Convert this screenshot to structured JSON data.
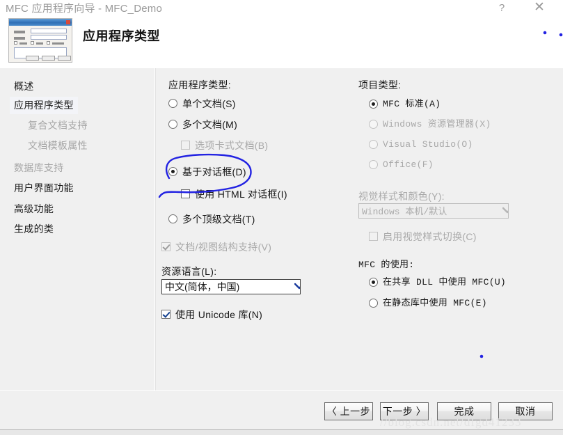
{
  "window": {
    "title": "MFC 应用程序向导 - MFC_Demo",
    "help_icon": "?",
    "close_icon": "✕"
  },
  "header": {
    "title": "应用程序类型",
    "icon_name": "wizard-dialog-preview-icon"
  },
  "sidebar": {
    "items": [
      {
        "label": "概述",
        "state": "normal",
        "indent": false
      },
      {
        "label": "应用程序类型",
        "state": "selected",
        "indent": false
      },
      {
        "label": "复合文档支持",
        "state": "disabled",
        "indent": true
      },
      {
        "label": "文档模板属性",
        "state": "disabled",
        "indent": true
      },
      {
        "label": "数据库支持",
        "state": "disabled",
        "indent": false
      },
      {
        "label": "用户界面功能",
        "state": "normal",
        "indent": false
      },
      {
        "label": "高级功能",
        "state": "normal",
        "indent": false
      },
      {
        "label": "生成的类",
        "state": "normal",
        "indent": false
      }
    ]
  },
  "app_type": {
    "group_label": "应用程序类型:",
    "options": [
      {
        "label": "单个文档(S)",
        "type": "radio",
        "checked": false,
        "disabled": false
      },
      {
        "label": "多个文档(M)",
        "type": "radio",
        "checked": false,
        "disabled": false
      },
      {
        "label": "选项卡式文档(B)",
        "type": "checkbox",
        "checked": false,
        "disabled": true
      },
      {
        "label": "基于对话框(D)",
        "type": "radio",
        "checked": true,
        "disabled": false
      },
      {
        "label": "使用 HTML 对话框(I)",
        "type": "checkbox",
        "checked": false,
        "disabled": false
      },
      {
        "label": "多个顶级文档(T)",
        "type": "radio",
        "checked": false,
        "disabled": false
      },
      {
        "label": "文档/视图结构支持(V)",
        "type": "checkbox",
        "checked": true,
        "disabled": true
      }
    ],
    "resource_language_label": "资源语言(L):",
    "resource_language_value": "中文(简体，中国)",
    "unicode_label": "使用 Unicode 库(N)",
    "unicode_checked": true
  },
  "project_type": {
    "group_label": "项目类型:",
    "options": [
      {
        "label": "MFC 标准(A)",
        "checked": true,
        "disabled": false
      },
      {
        "label": "Windows 资源管理器(X)",
        "checked": false,
        "disabled": true
      },
      {
        "label": "Visual Studio(O)",
        "checked": false,
        "disabled": true
      },
      {
        "label": "Office(F)",
        "checked": false,
        "disabled": true
      }
    ],
    "visual_style_label": "视觉样式和颜色(Y):",
    "visual_style_value": "Windows 本机/默认",
    "visual_style_disabled": true,
    "enable_switch_label": "启用视觉样式切换(C)",
    "enable_switch_checked": false,
    "enable_switch_disabled": true
  },
  "mfc_usage": {
    "group_label": "MFC 的使用:",
    "options": [
      {
        "label": "在共享 DLL 中使用 MFC(U)",
        "checked": true
      },
      {
        "label": "在静态库中使用 MFC(E)",
        "checked": false
      }
    ]
  },
  "footer": {
    "back_label": "〈 上一步",
    "next_label": "下一步 〉",
    "finish_label": "完成",
    "cancel_label": "取消"
  },
  "annotation": {
    "ink_color": "#2222E2",
    "target": "基于对话框(D)"
  },
  "watermark": {
    "text": "//blog.csdn.net/dfgd41233"
  }
}
